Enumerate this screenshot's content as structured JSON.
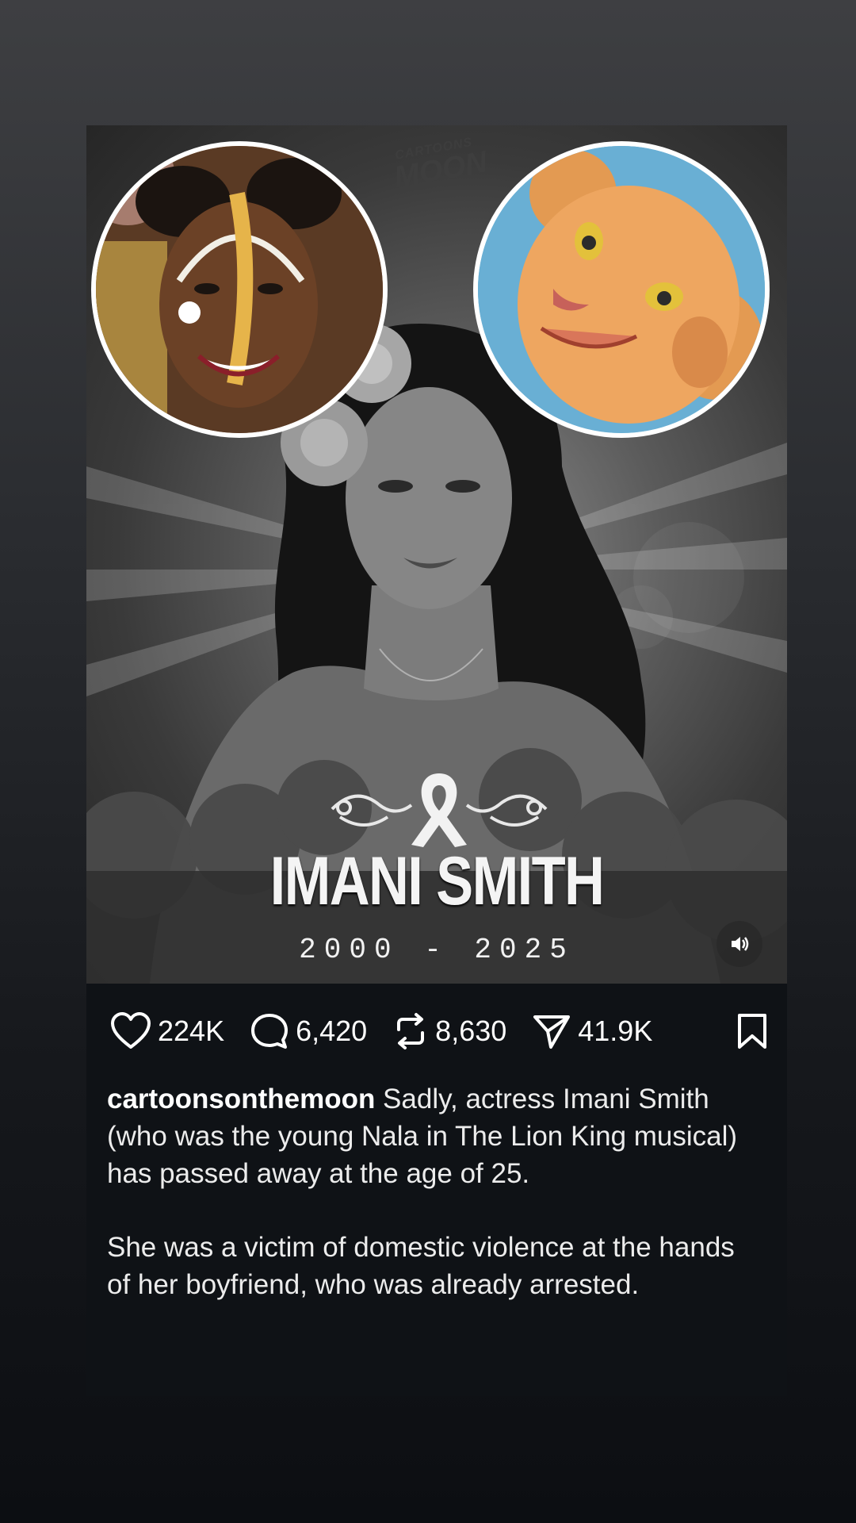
{
  "post": {
    "brand_logo_text": "CARTOONS ON THE MOON",
    "memorial_name": "IMANI SMITH",
    "memorial_years": "2000 - 2025",
    "images": {
      "left_circle": "child-actress-photo",
      "right_circle": "cartoon-lion-cub",
      "main": "memorial-portrait"
    }
  },
  "actions": {
    "likes": "224K",
    "comments": "6,420",
    "reposts": "8,630",
    "shares": "41.9K"
  },
  "caption": {
    "username": "cartoonsonthemoon",
    "paragraph1": " Sadly, actress Imani Smith (who was the young Nala in The Lion King musical) has passed away at the age of 25.",
    "paragraph2": "She was a victim of domestic violence at the hands of her boyfriend, who was already arrested."
  },
  "icons": {
    "like": "heart-icon",
    "comment": "comment-icon",
    "repost": "repost-icon",
    "share": "send-icon",
    "save": "bookmark-icon",
    "sound": "speaker-icon"
  },
  "colors": {
    "background_top": "#3e3f42",
    "background_bottom": "#0c0e12",
    "footer": "#0f1216",
    "text": "#ffffff"
  }
}
